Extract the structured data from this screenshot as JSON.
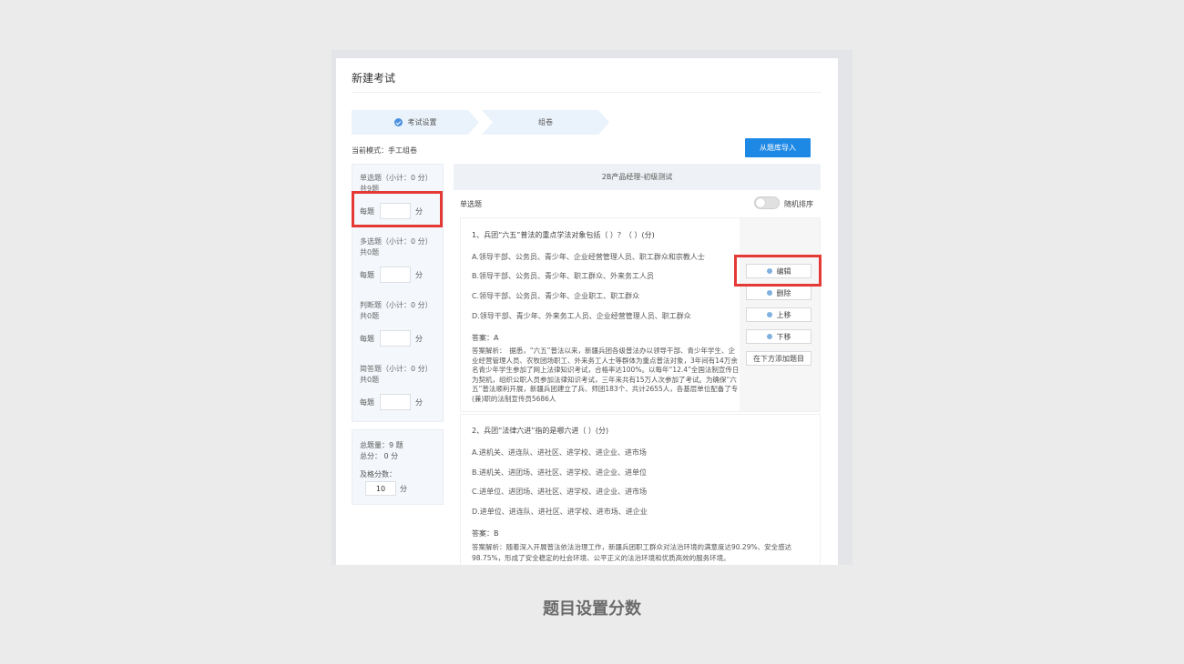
{
  "page": {
    "title": "新建考试",
    "caption": "题目设置分数"
  },
  "steps": [
    {
      "label": "考试设置",
      "done": true
    },
    {
      "label": "组卷",
      "done": false
    }
  ],
  "mode_text": "当前模式：手工组卷",
  "import_button": "从题库导入",
  "left_panel": {
    "sections": [
      {
        "title": "单选题（小计：0 分）",
        "count": "共9题",
        "per_label": "每题",
        "unit": "分"
      },
      {
        "title": "多选题（小计：0 分）",
        "count": "共0题",
        "per_label": "每题",
        "unit": "分"
      },
      {
        "title": "判断题（小计：0 分）",
        "count": "共0题",
        "per_label": "每题",
        "unit": "分"
      },
      {
        "title": "简答题（小计：0 分）",
        "count": "共0题",
        "per_label": "每题",
        "unit": "分"
      }
    ]
  },
  "summary": {
    "total_count": "总题量：9 题",
    "total_score": "总分： 0 分",
    "pass_label": "及格分数：",
    "pass_value": "10",
    "pass_unit": "分"
  },
  "paper": {
    "title": "2B产品经理-初级测试",
    "section_label": "单选题",
    "random_sort_label": "随机排序",
    "random_sort_on": false
  },
  "questions": [
    {
      "title": "1、兵团“六五”普法的重点学法对象包括（ ）？（ ）(分)",
      "options": [
        "A.领导干部、公务员、青少年、企业经营管理人员、职工群众和宗教人士",
        "B.领导干部、公务员、青少年、职工群众、外来务工人员",
        "C.领导干部、公务员、青少年、企业职工、职工群众",
        "D.领导干部、青少年、外来务工人员、企业经营管理人员、职工群众"
      ],
      "answer": "答案：A",
      "analysis": "答案解析：　据悉，“六五”普法以来，新疆兵团各级普法办以领导干部、青少年学生、企业经营管理人员、农牧团场职工、外来务工人士等群体为重点普法对象，3年间有14万余名青少年学生参加了网上法律知识考试，合格率达100%。以每年“12.4”全国法制宣传日为契机，组织公职人员参加法律知识考试，三年来共有15万人次参加了考试。为确保“六五”普法顺利开展，新疆兵团建立了兵、师团183个、共计2655人，各基层单位配备了专(兼)职的法制宣传员5686人"
    },
    {
      "title": "2、兵团“法律六进”指的是哪六进（ ）(分)",
      "options": [
        "A.进机关、进连队、进社区、进学校、进企业、进市场",
        "B.进机关、进团场、进社区、进学校、进企业、进单位",
        "C.进单位、进团场、进社区、进学校、进企业、进市场",
        "D.进单位、进连队、进社区、进学校、进市场、进企业"
      ],
      "answer": "答案：B",
      "analysis": "答案解析：随着深入开展普法依法治理工作，新疆兵团职工群众对法治环境的满意度达90.29%、安全感达98.75%，形成了安全稳定的社会环境、公平正义的法治环境和优质高效的服务环境。"
    }
  ],
  "actions": [
    "编辑",
    "删除",
    "上移",
    "下移",
    "在下方添加题目"
  ],
  "colors": {
    "primary": "#1e88e5",
    "highlight": "#e53935",
    "step_bg": "#eaf3fb"
  }
}
